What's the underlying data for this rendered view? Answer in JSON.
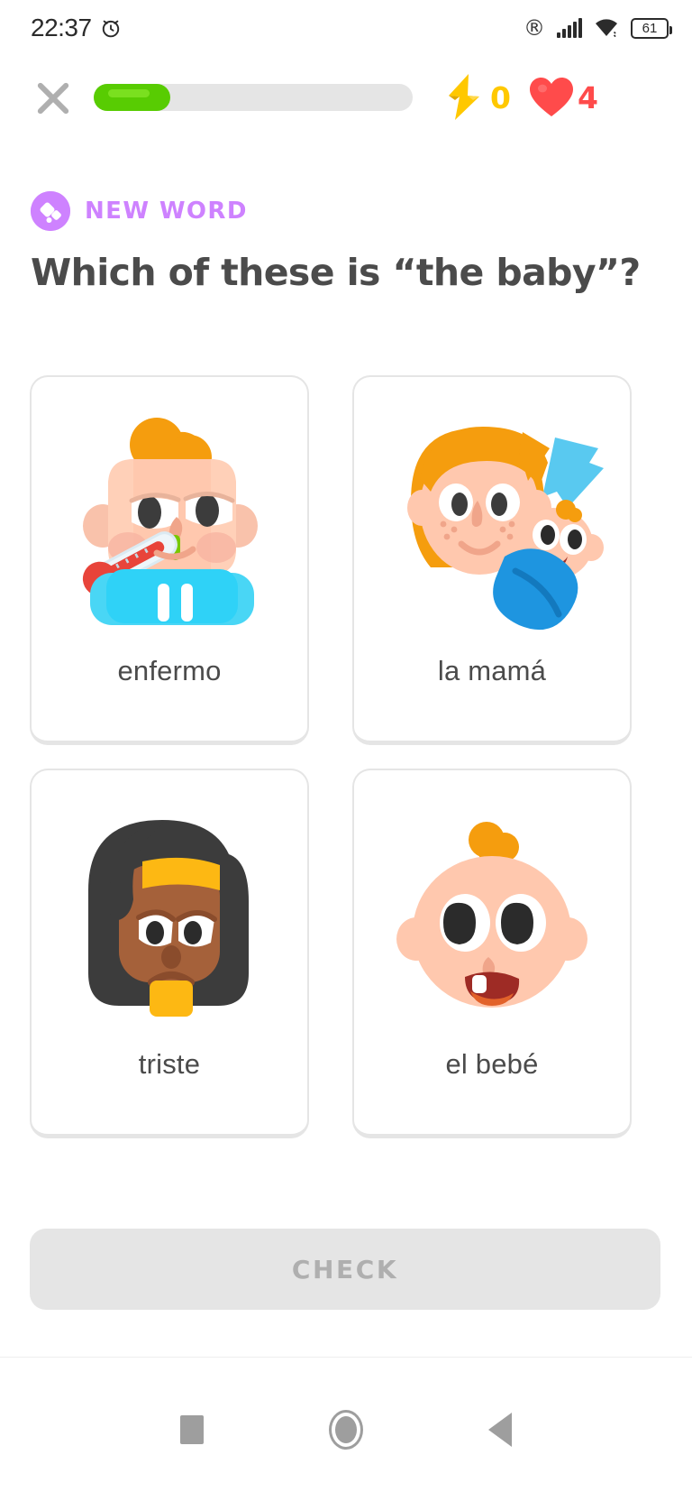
{
  "status_bar": {
    "time": "22:37",
    "alarm_icon": "alarm-clock-icon",
    "roaming_icon": "®",
    "signal_icon": "cellular-signal-icon",
    "wifi_icon": "wifi-icon",
    "battery_level": "61"
  },
  "lesson_header": {
    "close_icon": "close-x-icon",
    "progress_percent": 24,
    "xp_icon": "lightning-bolt-icon",
    "xp_value": "0",
    "hearts_icon": "heart-icon",
    "hearts_value": "4",
    "progress_fill_color": "#58cc02",
    "progress_track_color": "#e5e5e5",
    "xp_color": "#ffc800",
    "hearts_color": "#ff4b4b"
  },
  "exercise": {
    "badge_icon": "new-word-gem-icon",
    "badge_label": "NEW WORD",
    "badge_color": "#ce82ff",
    "question": "Which of these is “the baby”?",
    "choices": [
      {
        "label": "enfermo",
        "art": "sick-person-with-thermometer"
      },
      {
        "label": "la mamá",
        "art": "mother-holding-baby"
      },
      {
        "label": "triste",
        "art": "sad-woman-face"
      },
      {
        "label": "el bebé",
        "art": "baby-face"
      }
    ]
  },
  "footer": {
    "check_label": "CHECK",
    "check_enabled": false,
    "check_bg_color": "#e5e5e5",
    "check_text_color": "#afafaf"
  },
  "navigation_bar": {
    "recents_icon": "square-recents-icon",
    "home_icon": "circle-home-icon",
    "back_icon": "triangle-back-icon"
  }
}
